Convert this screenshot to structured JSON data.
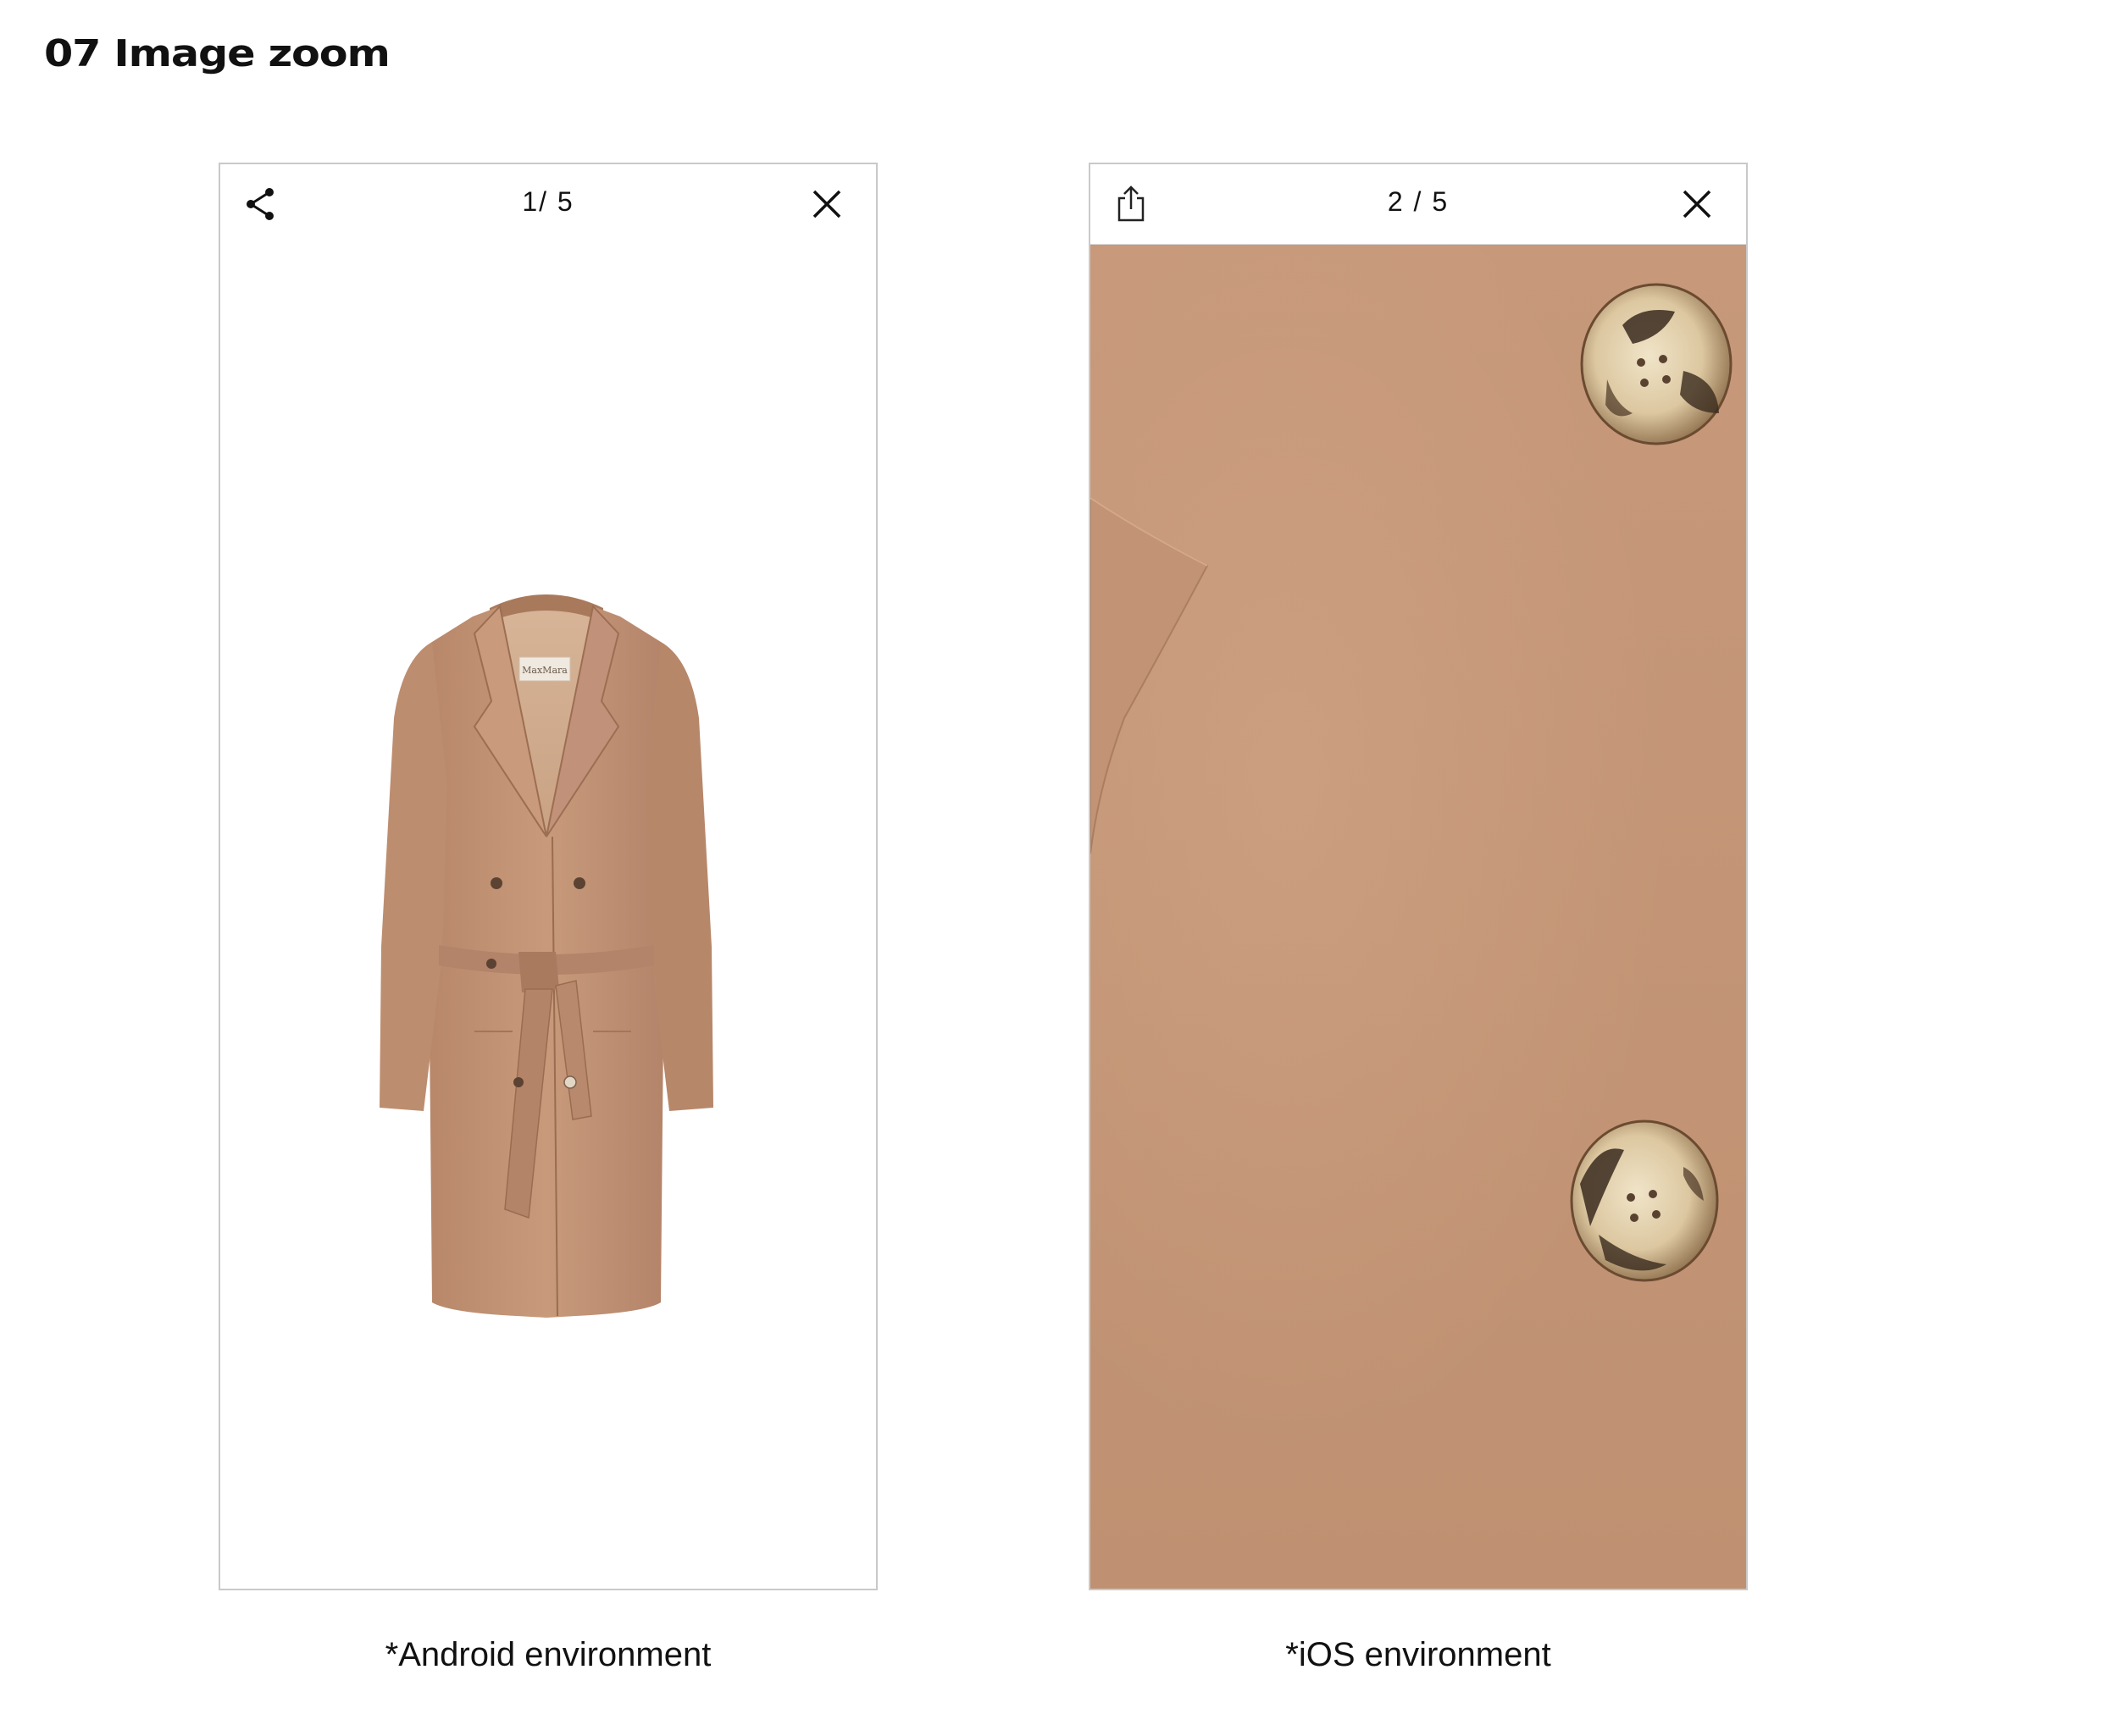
{
  "page": {
    "title": "07 Image zoom"
  },
  "android": {
    "counter": "1/ 5",
    "share_icon": "share-nodes-icon",
    "close_icon": "close-icon",
    "caption": "*Android environment",
    "image": "camel-coat-full-view",
    "label_text": "MaxMara"
  },
  "ios": {
    "counter": "2 / 5",
    "share_icon": "share-box-arrow-icon",
    "close_icon": "close-icon",
    "caption": "*iOS environment",
    "image": "camel-coat-zoomed-detail"
  },
  "colors": {
    "coat": "#c39272",
    "coat_dark": "#a87a5c",
    "fabric": "#c39576",
    "button_light": "#eadcc0",
    "button_dark": "#3a2a1e",
    "frame_border": "#c9c9c9"
  }
}
